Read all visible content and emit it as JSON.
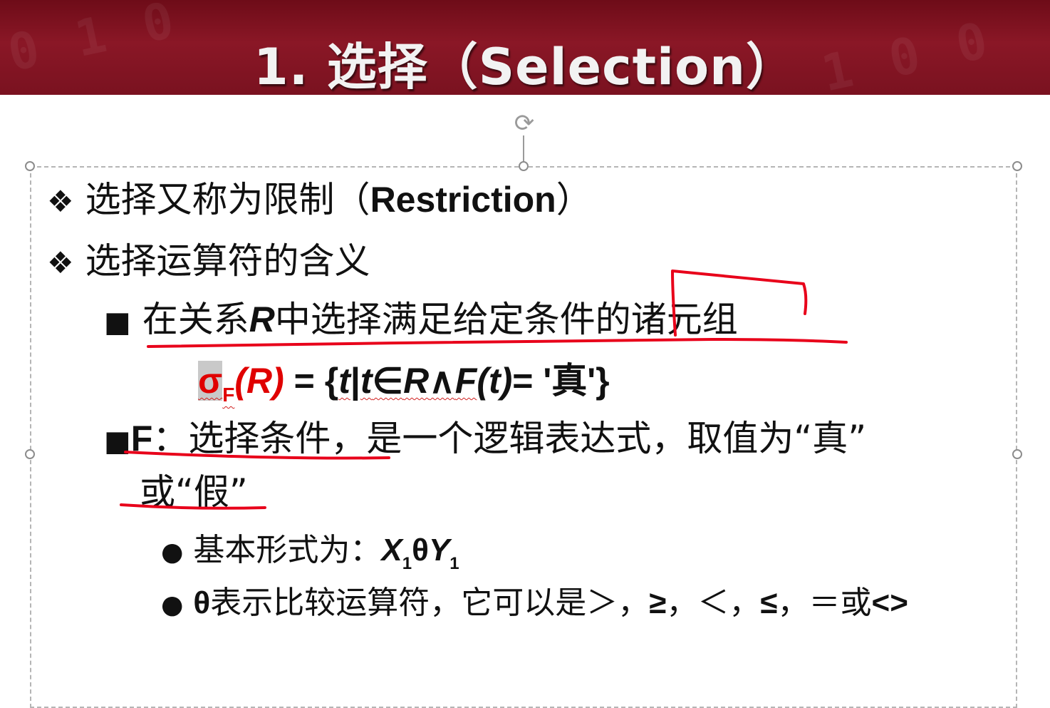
{
  "slide": {
    "title": "1. 选择（Selection）",
    "bullet_l1_symbol": "❖",
    "bullet_l2_symbol": "■",
    "bullet_l3_symbol": "●",
    "line1": {
      "text": "选择又称为限制（",
      "latin": "Restriction",
      "close": "）"
    },
    "line2": {
      "text": "选择运算符的含义"
    },
    "line3": {
      "a": "在关系",
      "r": "R",
      "b": "中选择满足给定条件的诸元组"
    },
    "formula": {
      "sigma": "σ",
      "sub": "F",
      "arg": "(R)",
      "eq": " = {",
      "t1": "t",
      "bar": "|",
      "t2": "t",
      "in": "∈",
      "R": "R",
      "and": "∧",
      "F": "F",
      "t3": "(t)",
      "rest": "= '真'}"
    },
    "line4": {
      "F": "F",
      "a": "：选择条件，是一个逻辑表达式，取值为“真”"
    },
    "line5": {
      "text": "或“假”"
    },
    "line6": {
      "label": "基本形式为：",
      "x": "X",
      "x_sub": "1",
      "theta": "θ",
      "y": "Y",
      "y_sub": "1"
    },
    "line7": {
      "theta": "θ",
      "text": "表示比较运算符，它可以是＞，",
      "ge": "≥",
      "c1": "，＜，",
      "le": "≤",
      "c2": "，＝或",
      "ne": "<>"
    }
  },
  "colors": {
    "title_bg": "#7a1220",
    "title_text": "#f2f2f2",
    "accent_red": "#e00000",
    "ink_red": "#e8001a"
  },
  "icons": {
    "rotate_handle": "rotate-icon",
    "resize_handle": "handle"
  }
}
